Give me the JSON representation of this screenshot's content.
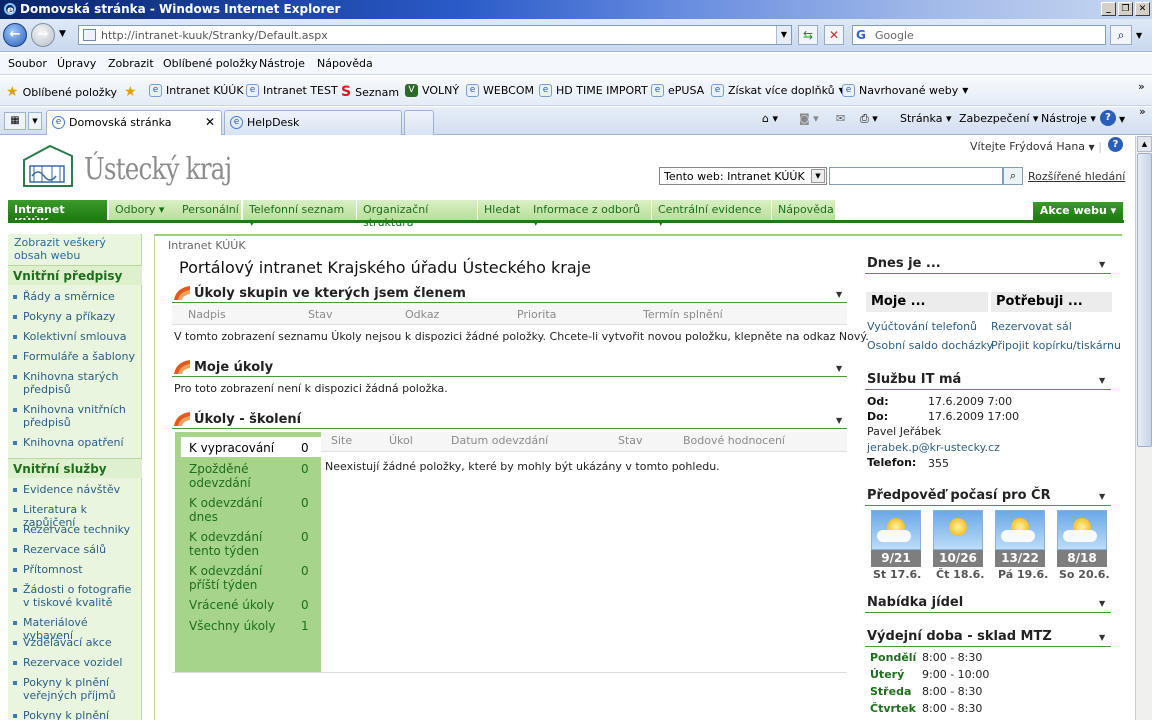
{
  "window": {
    "title": "Domovská stránka - Windows Internet Explorer"
  },
  "address": {
    "url": "http://intranet-kuuk/Stranky/Default.aspx",
    "search_placeholder": "Google"
  },
  "menu": [
    "Soubor",
    "Úpravy",
    "Zobrazit",
    "Oblíbené položky",
    "Nástroje",
    "Nápověda"
  ],
  "favorites": {
    "label": "Oblíbené položky",
    "items": [
      "Intranet KÚÚK",
      "Intranet TEST",
      "Seznam",
      "VOLNÝ",
      "WEBCOM",
      "HD TIME IMPORT",
      "ePUSA",
      "Získat více doplňků",
      "Navrhované weby"
    ]
  },
  "tabs": [
    {
      "label": "Domovská stránka"
    },
    {
      "label": "HelpDesk"
    }
  ],
  "toolbar": {
    "page": "Stránka",
    "safety": "Zabezpečení",
    "tools": "Nástroje"
  },
  "site": {
    "logo_text": "Ústecký kraj",
    "welcome": "Vítejte Frýdová Hana",
    "scope": "Tento web: Intranet KÚÚK",
    "adv_search": "Rozšířené hledání",
    "site_actions": "Akce webu"
  },
  "topnav": [
    "Intranet KÚÚK",
    "Odbory",
    "Personální",
    "Telefonní seznam",
    "Organizační struktura",
    "Hledat",
    "Informace z odborů",
    "Centrální evidence",
    "Nápověda"
  ],
  "leftnav": {
    "view_all": "Zobrazit veškerý obsah webu",
    "section1": "Vnitřní předpisy",
    "links1": [
      "Řády a směrnice",
      "Pokyny a příkazy",
      "Kolektivní smlouva",
      "Formuláře a šablony",
      "Knihovna starých předpisů",
      "Knihovna vnitřních předpisů",
      "Knihovna opatření"
    ],
    "section2": "Vnitřní služby",
    "links2": [
      "Evidence návštěv",
      "Literatura k zapůjčení",
      "Rezervace techniky",
      "Rezervace sálů",
      "Přítomnost",
      "Žádosti o fotografie v tiskové kvalitě",
      "Materiálové vybavení",
      "Vzdělávací akce",
      "Rezervace vozidel",
      "Pokyny k plnění veřejných příjmů",
      "Pokyny k plnění"
    ]
  },
  "main": {
    "breadcrumb": "Intranet KÚÚK",
    "title": "Portálový intranet Krajského úřadu Ústeckého kraje",
    "wp1": {
      "title": "Úkoly skupin ve kterých jsem členem",
      "columns": [
        "Nadpis",
        "Stav",
        "Odkaz",
        "Priorita",
        "Termín splnění"
      ],
      "message": "V tomto zobrazení seznamu Úkoly nejsou k dispozici žádné položky. Chcete-li vytvořit novou položku, klepněte na odkaz Nový."
    },
    "wp2": {
      "title": "Moje úkoly",
      "message": "Pro toto zobrazení není k dispozici žádná položka."
    },
    "wp3": {
      "title": "Úkoly - školení",
      "columns": [
        "Site",
        "Úkol",
        "Datum odevzdání",
        "Stav",
        "Bodové hodnocení"
      ],
      "message": "Neexistují žádné položky, které by mohly být ukázány v tomto pohledu.",
      "filters": [
        {
          "label": "K vypracování",
          "count": "0"
        },
        {
          "label": "Zpožděné odevzdání",
          "count": "0"
        },
        {
          "label": "K odevzdání dnes",
          "count": "0"
        },
        {
          "label": "K odevzdání tento týden",
          "count": "0"
        },
        {
          "label": "K odevzdání příští týden",
          "count": "0"
        },
        {
          "label": "Vrácené úkoly",
          "count": "0"
        },
        {
          "label": "Všechny úkoly",
          "count": "1"
        }
      ]
    }
  },
  "right": {
    "today": "Dnes je ...",
    "me_hdr": "Moje ...",
    "need_hdr": "Potřebuji ...",
    "me_links": [
      "Vyúčtování telefonů",
      "Osobní saldo docházky"
    ],
    "need_links": [
      "Rezervovat sál",
      "Připojit kopírku/tiskárnu"
    ],
    "it": {
      "title": "Službu IT má",
      "from_label": "Od:",
      "from": "17.6.2009 7:00",
      "to_label": "Do:",
      "to": "17.6.2009 17:00",
      "name": "Pavel Jeřábek",
      "email": "jerabek.p@kr-ustecky.cz",
      "phone_label": "Telefon:",
      "phone": "355"
    },
    "weather": {
      "title": "Předpověď počasí pro ČR",
      "days": [
        {
          "temp": "9/21",
          "day": "St 17.6."
        },
        {
          "temp": "10/26",
          "day": "Čt 18.6."
        },
        {
          "temp": "13/22",
          "day": "Pá 19.6."
        },
        {
          "temp": "8/18",
          "day": "So 20.6."
        }
      ]
    },
    "menu_title": "Nabídka jídel",
    "store": {
      "title": "Výdejní doba - sklad MTZ",
      "rows": [
        {
          "day": "Pondělí",
          "time": "8:00 - 8:30"
        },
        {
          "day": "Úterý",
          "time": "9:00 - 10:00"
        },
        {
          "day": "Středa",
          "time": "8:00 - 8:30"
        },
        {
          "day": "Čtvrtek",
          "time": "8:00 - 8:30"
        }
      ]
    }
  }
}
